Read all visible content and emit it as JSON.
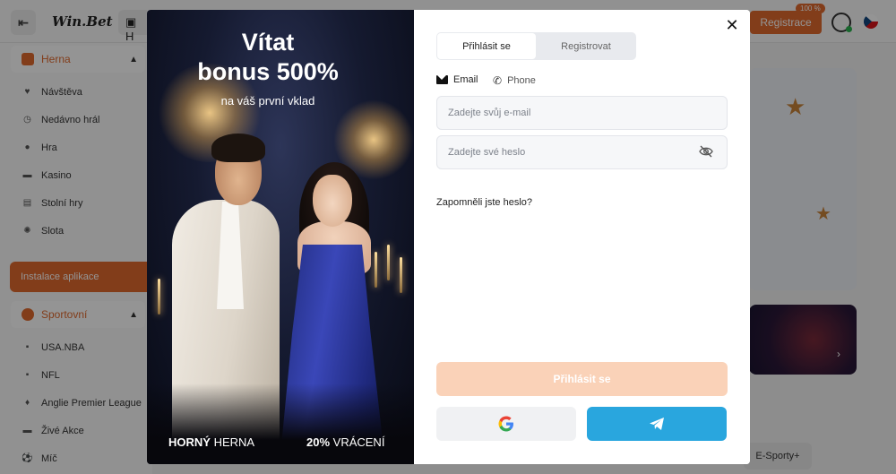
{
  "topbar": {
    "logo": "Win.Bet",
    "tab_partial": "H",
    "register_label": "Registrace",
    "bonus_badge": "100 %"
  },
  "sidebar": {
    "herna_label": "Herna",
    "herna_items": [
      "Návštěva",
      "Nedávno hrál",
      "Hra",
      "Kasino",
      "Stolní hry",
      "Slota"
    ],
    "install_label": "Instalace aplikace",
    "sport_label": "Sportovní",
    "sport_items": [
      "USA.NBA",
      "NFL",
      "Anglie Premier League",
      "Živé Akce",
      "Míč"
    ],
    "esport_label": "E-Sporty+"
  },
  "promo": {
    "title_line1": "Vítat",
    "title_line2": "bonus 500%",
    "subtitle": "na váš první vklad",
    "footer_left_bold": "HORNÝ",
    "footer_left_rest": " HERNA",
    "footer_right_bold": "20%",
    "footer_right_rest": " VRÁCENÍ"
  },
  "form": {
    "tab_login": "Přihlásit se",
    "tab_register": "Registrovat",
    "method_email": "Email",
    "method_phone": "Phone",
    "email_placeholder": "Zadejte svůj e-mail",
    "password_placeholder": "Zadejte své heslo",
    "forgot_link": "Zapomněli jste heslo?",
    "submit_label": "Přihlásit se"
  },
  "colors": {
    "accent": "#e06a2e",
    "submit_disabled": "#fad2b8",
    "telegram": "#29a6de"
  }
}
